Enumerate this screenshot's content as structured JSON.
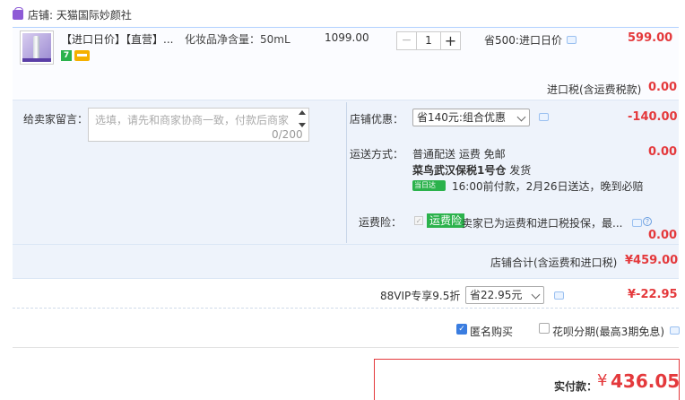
{
  "shop": {
    "label": "店铺: 天猫国际妙颜社"
  },
  "item": {
    "title": "【进口日价】【直营】...",
    "spec": "化妆品净含量：50mL",
    "original_price": "1099.00",
    "quantity": "1",
    "qty_minus": "−",
    "qty_plus": "+",
    "promo": "省500:进口日价",
    "subtotal": "599.00",
    "badge_7": "7"
  },
  "tax": {
    "label": "进口税(含运费税款)",
    "value": "0.00"
  },
  "message": {
    "label": "给卖家留言：",
    "placeholder": "选填，请先和商家协商一致，付款后商家",
    "count": "0/200"
  },
  "shop_discount": {
    "label": "店铺优惠：",
    "selected": "省140元:组合优惠",
    "value": "-140.00"
  },
  "shipping": {
    "label": "运送方式：",
    "line1": "普通配送 运费 免邮",
    "value": "0.00",
    "warehouse": "菜鸟武汉保税1号仓",
    "ship_text": "发货",
    "day_badge": "当日达",
    "line3": "16:00前付款，2月26日送达，晚到必赔"
  },
  "insurance": {
    "label": "运费险：",
    "tag": "运费险",
    "text": "卖家已为运费和进口税投保，最...",
    "value": "0.00",
    "help": "?"
  },
  "shop_total": {
    "label": "店铺合计(含运费和进口税)",
    "value": "¥459.00"
  },
  "vip": {
    "label": "88VIP专享9.5折",
    "selected": "省22.95元",
    "value": "¥-22.95"
  },
  "options": {
    "anonymous": "匿名购买",
    "anonymous_checked": true,
    "huabei": "花呗分期(最高3期免息)",
    "huabei_checked": false,
    "check_mark": "✓"
  },
  "payment": {
    "label": "实付款：",
    "currency": "¥",
    "amount": "436.05"
  },
  "colors": {
    "accent": "#e4393c",
    "green_badge": "#2bb24c",
    "panel_bg": "#eef3fb"
  }
}
